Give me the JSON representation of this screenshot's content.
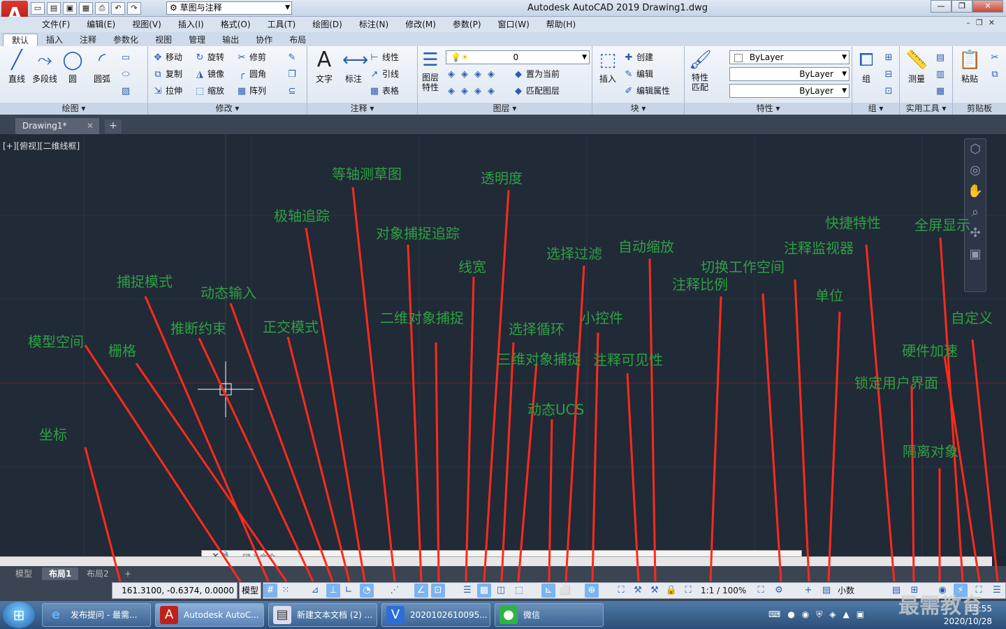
{
  "titlebar": {
    "logo": "A",
    "workspace": "草图与注释",
    "title": "Autodesk AutoCAD 2019    Drawing1.dwg"
  },
  "menus": [
    "文件(F)",
    "编辑(E)",
    "视图(V)",
    "插入(I)",
    "格式(O)",
    "工具(T)",
    "绘图(D)",
    "标注(N)",
    "修改(M)",
    "参数(P)",
    "窗口(W)",
    "帮助(H)"
  ],
  "ribbon_tabs": [
    "默认",
    "插入",
    "注释",
    "参数化",
    "视图",
    "管理",
    "输出",
    "协作",
    "布局"
  ],
  "ribbon": {
    "draw": {
      "title": "绘图 ▾",
      "line": "直线",
      "polyline": "多段线",
      "circle": "圆",
      "arc": "圆弧"
    },
    "modify": {
      "title": "修改 ▾",
      "move": "移动",
      "rotate": "旋转",
      "trim": "修剪",
      "copy": "复制",
      "mirror": "镜像",
      "fillet": "圆角",
      "stretch": "拉伸",
      "scale": "缩放",
      "array": "阵列"
    },
    "annotation": {
      "title": "注释 ▾",
      "text": "文字",
      "dimension": "标注",
      "linear": "线性",
      "leader": "引线",
      "table": "表格"
    },
    "layers": {
      "title": "图层 ▾",
      "props": "图层特性",
      "layer_value": "0",
      "set_current": "置为当前",
      "match_layer": "匹配图层"
    },
    "block": {
      "title": "块 ▾",
      "insert": "插入",
      "create": "创建",
      "edit": "编辑",
      "edit_attr": "编辑属性"
    },
    "properties": {
      "title": "特性 ▾",
      "match": "特性匹配",
      "color": "ByLayer",
      "linetype": "ByLayer",
      "lineweight": "ByLayer"
    },
    "groups": {
      "title": "组 ▾",
      "group": "组"
    },
    "utilities": {
      "title": "实用工具 ▾",
      "measure": "测量"
    },
    "clipboard": {
      "title": "剪贴板",
      "paste": "粘贴"
    }
  },
  "file_tab": "Drawing1*",
  "view_label": "[+][俯视][二维线框]",
  "command": {
    "placeholder": "键入命令"
  },
  "layout_tabs": [
    "模型",
    "布局1",
    "布局2"
  ],
  "status": {
    "coords": "161.3100, -0.6374, 0.0000",
    "model": "模型",
    "scale": "1:1 / 100%",
    "units": "小数"
  },
  "taskbar": [
    {
      "label": "发布提问 - 最需..."
    },
    {
      "label": "Autodesk AutoC..."
    },
    {
      "label": "新建文本文档 (2) ..."
    },
    {
      "label": "2020102610095..."
    },
    {
      "label": "微信"
    }
  ],
  "clock": {
    "time": "15:55",
    "date": "2020/10/28"
  },
  "watermark": "最需教育",
  "annotations": {
    "iso_draft": "等轴测草图",
    "transparency": "透明度",
    "polar": "极轴追踪",
    "osnap_track": "对象捕捉追踪",
    "lineweight": "线宽",
    "sel_filter": "选择过滤",
    "autoscale": "自动缩放",
    "switch_ws": "切换工作空间",
    "anno_scale": "注释比例",
    "quick_props": "快捷特性",
    "fullscreen": "全屏显示",
    "anno_monitor": "注释监视器",
    "snap": "捕捉模式",
    "dyn_input": "动态输入",
    "infer": "推断约束",
    "ortho": "正交模式",
    "osnap2d": "二维对象捕捉",
    "sel_cycle": "选择循环",
    "gizmo": "小控件",
    "units": "单位",
    "model_space": "模型空间",
    "grid": "栅格",
    "osnap3d": "三维对象捕捉",
    "anno_vis": "注释可见性",
    "custom": "自定义",
    "hw_accel": "硬件加速",
    "lock_ui": "锁定用户界面",
    "dyn_ucs": "动态UCS",
    "coords": "坐标",
    "isolate": "隔离对象"
  },
  "colors": {
    "accent": "#2ea043",
    "arrow": "#ff2a1a",
    "canvas": "#212a37"
  }
}
